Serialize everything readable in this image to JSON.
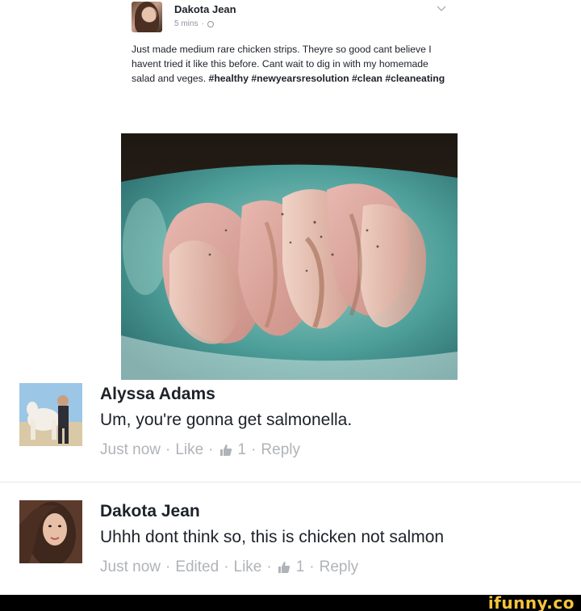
{
  "post": {
    "author": "Dakota Jean",
    "time": "5 mins",
    "separator": "·",
    "text": "Just made medium rare chicken strips. Theyre so good cant believe I havent tried it like this before. Cant wait to dig in with my homemade salad and veges.",
    "hashtags": "#healthy #newyearsresolution #clean #cleaneating",
    "photo_subject": "sliced undercooked chicken strips on a blue plate"
  },
  "comments": [
    {
      "author": "Alyssa Adams",
      "text": "Um, you're gonna get salmonella.",
      "time": "Just now",
      "edited": "",
      "like": "Like",
      "like_count": "1",
      "reply": "Reply",
      "sep": "·"
    },
    {
      "author": "Dakota Jean",
      "text": "Uhhh dont think so, this is chicken not salmon",
      "time": "Just now",
      "edited": "Edited",
      "like": "Like",
      "like_count": "1",
      "reply": "Reply",
      "sep": "·"
    }
  ],
  "watermark": {
    "text": "ifunny.co"
  },
  "colors": {
    "text": "#1d2129",
    "meta": "#90949c",
    "actions": "#b0b3b8",
    "watermark": "#f6c33c"
  }
}
